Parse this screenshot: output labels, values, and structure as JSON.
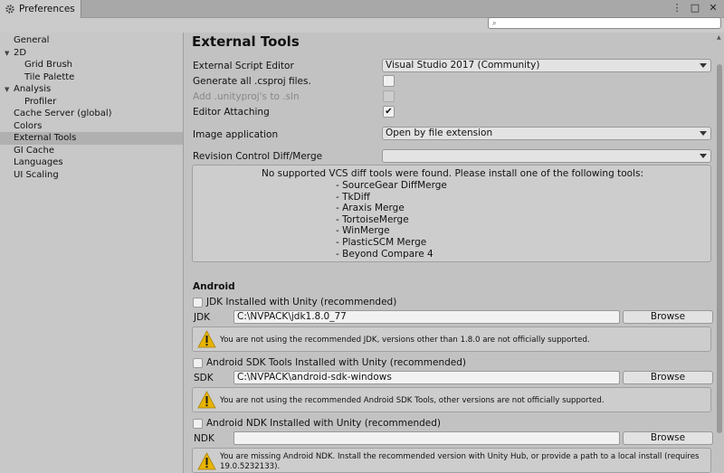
{
  "window": {
    "tab_title": "Preferences",
    "controls": [
      "⋮",
      "□",
      "✕"
    ]
  },
  "search": {
    "placeholder": "",
    "value": ""
  },
  "sidebar": {
    "items": [
      {
        "label": "General",
        "level": 0,
        "selected": false
      },
      {
        "label": "2D",
        "level": 0,
        "group": true,
        "expanded": true
      },
      {
        "label": "Grid Brush",
        "level": 1
      },
      {
        "label": "Tile Palette",
        "level": 1
      },
      {
        "label": "Analysis",
        "level": 0,
        "group": true,
        "expanded": true
      },
      {
        "label": "Profiler",
        "level": 1
      },
      {
        "label": "Cache Server (global)",
        "level": 0
      },
      {
        "label": "Colors",
        "level": 0
      },
      {
        "label": "External Tools",
        "level": 0,
        "selected": true
      },
      {
        "label": "GI Cache",
        "level": 0
      },
      {
        "label": "Languages",
        "level": 0
      },
      {
        "label": "UI Scaling",
        "level": 0
      }
    ]
  },
  "main": {
    "title": "External Tools",
    "external_script_editor": {
      "label": "External Script Editor",
      "value": "Visual Studio 2017 (Community)"
    },
    "generate_csproj": {
      "label": "Generate all .csproj files.",
      "checked": false
    },
    "add_unityproj": {
      "label": "Add .unityproj's to .sln",
      "checked": false,
      "disabled": true
    },
    "editor_attaching": {
      "label": "Editor Attaching",
      "checked": true
    },
    "image_application": {
      "label": "Image application",
      "value": "Open by file extension"
    },
    "revision_control": {
      "label": "Revision Control Diff/Merge",
      "value": ""
    },
    "vcs": {
      "message": "No supported VCS diff tools were found. Please install one of the following tools:",
      "tools": [
        "- SourceGear DiffMerge",
        "- TkDiff",
        "- Araxis Merge",
        "- TortoiseMerge",
        "- WinMerge",
        "- PlasticSCM Merge",
        "- Beyond Compare 4"
      ]
    },
    "android": {
      "title": "Android",
      "jdk_installed": {
        "label": "JDK Installed with Unity (recommended)",
        "checked": false
      },
      "jdk": {
        "label": "JDK",
        "path": "C:\\NVPACK\\jdk1.8.0_77",
        "browse": "Browse",
        "warning": "You are not using the recommended JDK, versions other than 1.8.0 are not officially supported."
      },
      "sdk_installed": {
        "label": "Android SDK Tools Installed with Unity (recommended)",
        "checked": false
      },
      "sdk": {
        "label": "SDK",
        "path": "C:\\NVPACK\\android-sdk-windows",
        "browse": "Browse",
        "warning": "You are not using the recommended Android SDK Tools, other versions are not officially supported."
      },
      "ndk_installed": {
        "label": "Android NDK Installed with Unity (recommended)",
        "checked": false
      },
      "ndk": {
        "label": "NDK",
        "path": "",
        "browse": "Browse",
        "warning_line1": "You are missing Android NDK. Install the recommended version with Unity Hub, or provide a path to a local install (requires",
        "warning_line2": "19.0.5232133)."
      }
    }
  },
  "colors": {
    "warning_icon": "#e8b400",
    "selected_item": "#b0b0b0"
  }
}
